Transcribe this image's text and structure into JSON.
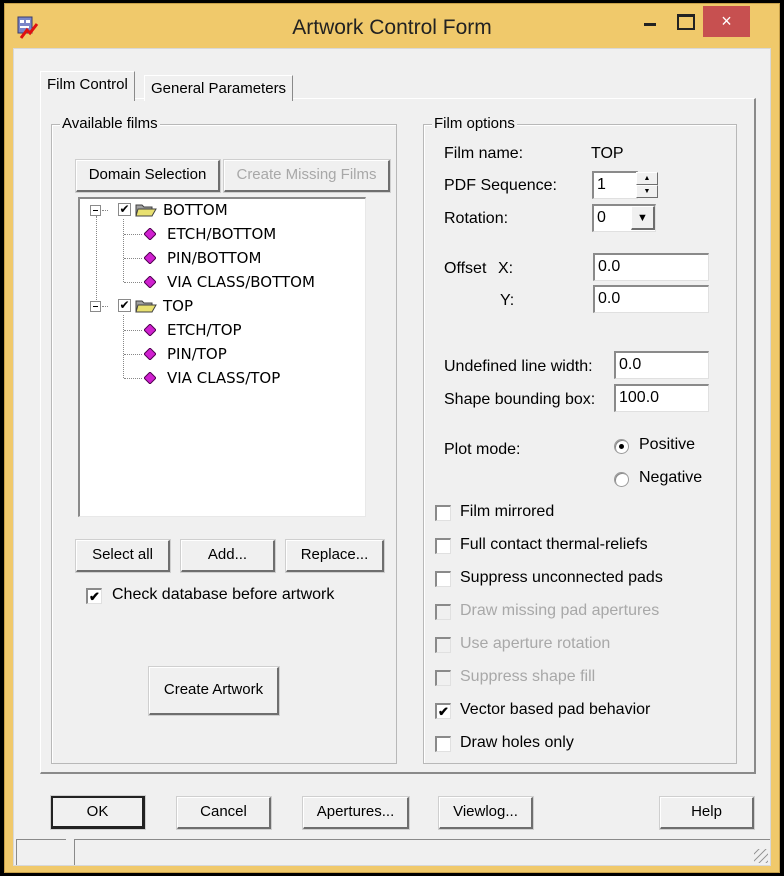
{
  "window": {
    "title": "Artwork Control Form",
    "controls": {
      "minimize": "minimize-icon",
      "maximize": "maximize-icon",
      "close": "×"
    }
  },
  "tabs": [
    {
      "label": "Film Control",
      "active": true
    },
    {
      "label": "General Parameters",
      "active": false
    }
  ],
  "available_films": {
    "label": "Available films",
    "domain_selection": "Domain Selection",
    "create_missing_films": "Create Missing Films",
    "tree": [
      {
        "label": "BOTTOM",
        "checked": true,
        "expanded": true,
        "children": [
          "ETCH/BOTTOM",
          "PIN/BOTTOM",
          "VIA CLASS/BOTTOM"
        ]
      },
      {
        "label": "TOP",
        "checked": true,
        "expanded": true,
        "children": [
          "ETCH/TOP",
          "PIN/TOP",
          "VIA CLASS/TOP"
        ]
      }
    ],
    "select_all": "Select all",
    "add": "Add...",
    "replace": "Replace...",
    "check_db": {
      "label": "Check database before artwork",
      "checked": true
    },
    "create_artwork": "Create Artwork"
  },
  "film_options": {
    "label": "Film options",
    "film_name_label": "Film name:",
    "film_name_value": "TOP",
    "pdf_sequence_label": "PDF Sequence:",
    "pdf_sequence_value": "1",
    "rotation_label": "Rotation:",
    "rotation_value": "0",
    "offset_label": "Offset",
    "offset_x_label": "X:",
    "offset_x_value": "0.0",
    "offset_y_label": "Y:",
    "offset_y_value": "0.0",
    "undefined_line_width_label": "Undefined line width:",
    "undefined_line_width_value": "0.0",
    "shape_bounding_box_label": "Shape bounding box:",
    "shape_bounding_box_value": "100.0",
    "plot_mode_label": "Plot mode:",
    "plot_mode_options": [
      "Positive",
      "Negative"
    ],
    "plot_mode_selected": "Positive",
    "checkboxes": [
      {
        "label": "Film mirrored",
        "checked": false,
        "enabled": true
      },
      {
        "label": "Full contact thermal-reliefs",
        "checked": false,
        "enabled": true
      },
      {
        "label": "Suppress unconnected pads",
        "checked": false,
        "enabled": true
      },
      {
        "label": "Draw missing pad apertures",
        "checked": false,
        "enabled": false
      },
      {
        "label": "Use aperture rotation",
        "checked": false,
        "enabled": false
      },
      {
        "label": "Suppress shape fill",
        "checked": false,
        "enabled": false
      },
      {
        "label": "Vector based pad behavior",
        "checked": true,
        "enabled": true
      },
      {
        "label": "Draw holes only",
        "checked": false,
        "enabled": true
      }
    ]
  },
  "footer_buttons": {
    "ok": "OK",
    "cancel": "Cancel",
    "apertures": "Apertures...",
    "viewlog": "Viewlog...",
    "help": "Help"
  },
  "colors": {
    "frame": "#f0c96b",
    "close_button": "#c75050",
    "dialog_bg": "#f0f0f0",
    "disabled_text": "#a8a8a8",
    "film_diamond": "#d020d0",
    "folder": "#e8e070"
  }
}
